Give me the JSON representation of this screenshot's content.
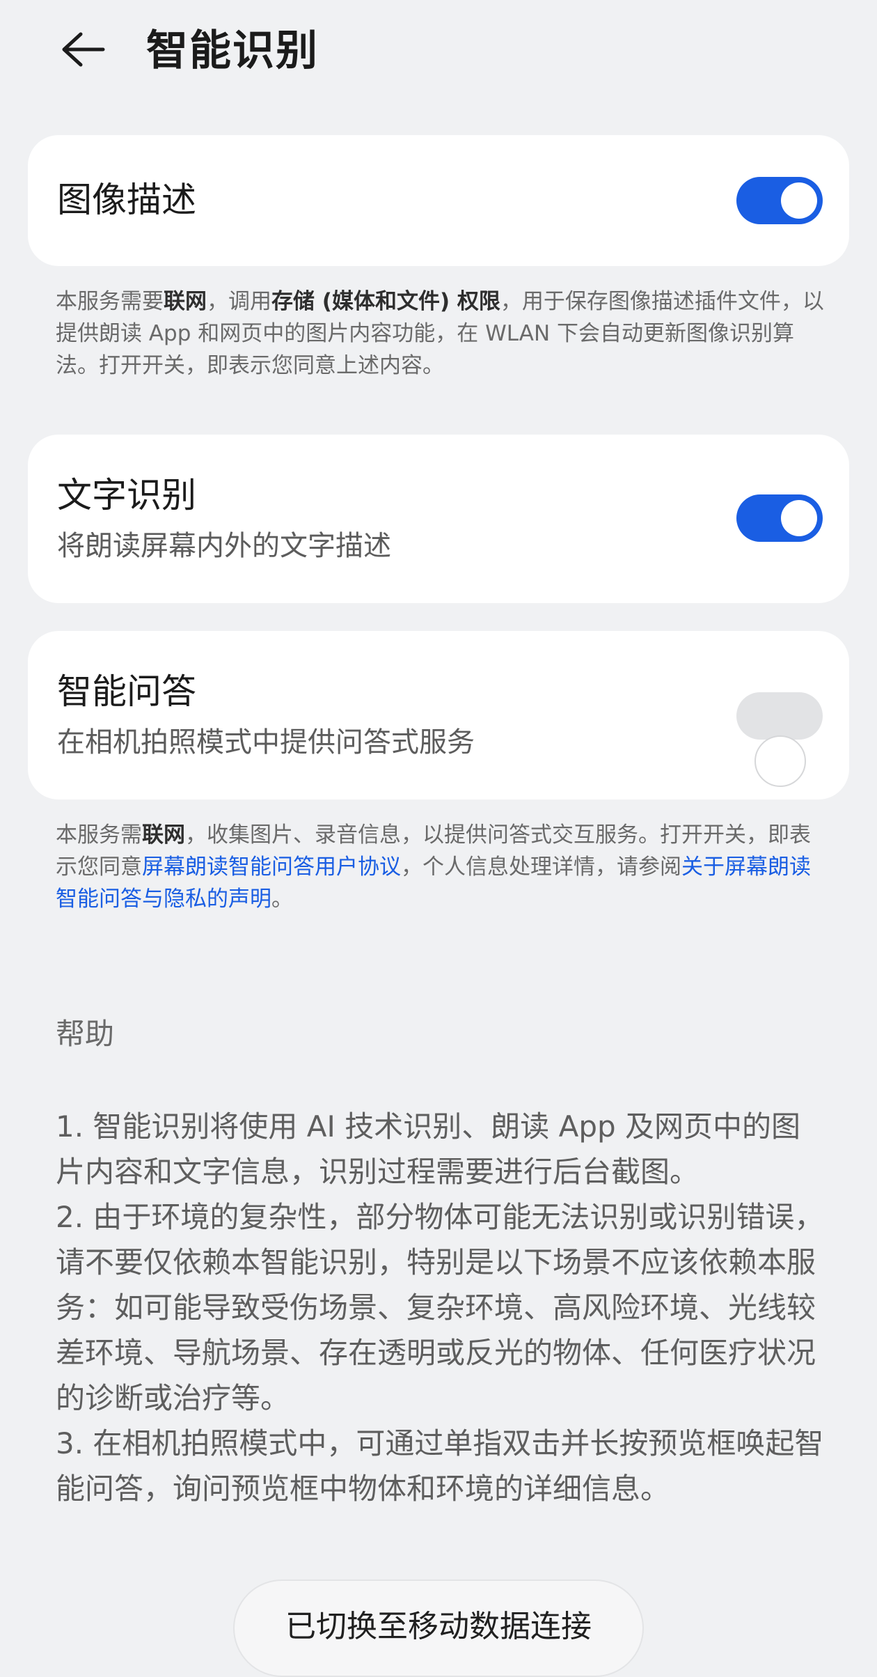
{
  "header": {
    "title": "智能识别"
  },
  "image_description": {
    "label": "图像描述",
    "enabled": true,
    "note": {
      "p1": "本服务需要",
      "b1": "联网",
      "p2": "，调用",
      "b2": "存储 (媒体和文件) 权限",
      "p3": "，用于保存图像描述插件文件，以提供朗读 App 和网页中的图片内容功能，在 WLAN 下会自动更新图像识别算法。打开开关，即表示您同意上述内容。"
    }
  },
  "text_recognition": {
    "label": "文字识别",
    "subtitle": "将朗读屏幕内外的文字描述",
    "enabled": true
  },
  "smart_qa": {
    "label": "智能问答",
    "subtitle": "在相机拍照模式中提供问答式服务",
    "enabled": false,
    "note": {
      "p1": "本服务需",
      "b1": "联网",
      "p2": "，收集图片、录音信息，以提供问答式交互服务。打开开关，即表示您同意",
      "link1": "屏幕朗读智能问答用户协议",
      "p3": "，个人信息处理详情，请参阅",
      "link2": "关于屏幕朗读智能问答与隐私的声明",
      "p4": "。"
    }
  },
  "help": {
    "title": "帮助",
    "items": [
      "1. 智能识别将使用 AI 技术识别、朗读 App 及网页中的图片内容和文字信息，识别过程需要进行后台截图。",
      "2. 由于环境的复杂性，部分物体可能无法识别或识别错误，请不要仅依赖本智能识别，特别是以下场景不应该依赖本服务：如可能导致受伤场景、复杂环境、高风险环境、光线较差环境、导航场景、存在透明或反光的物体、任何医疗状况的诊断或治疗等。",
      "3. 在相机拍照模式中，可通过单指双击并长按预览框唤起智能问答，询问预览框中物体和环境的详细信息。"
    ]
  },
  "toast": {
    "text": "已切换至移动数据连接"
  },
  "colors": {
    "accent": "#1a5ee3",
    "background": "#f0f1f3",
    "card": "#ffffff"
  },
  "icons": {
    "back": "back-arrow-icon"
  }
}
